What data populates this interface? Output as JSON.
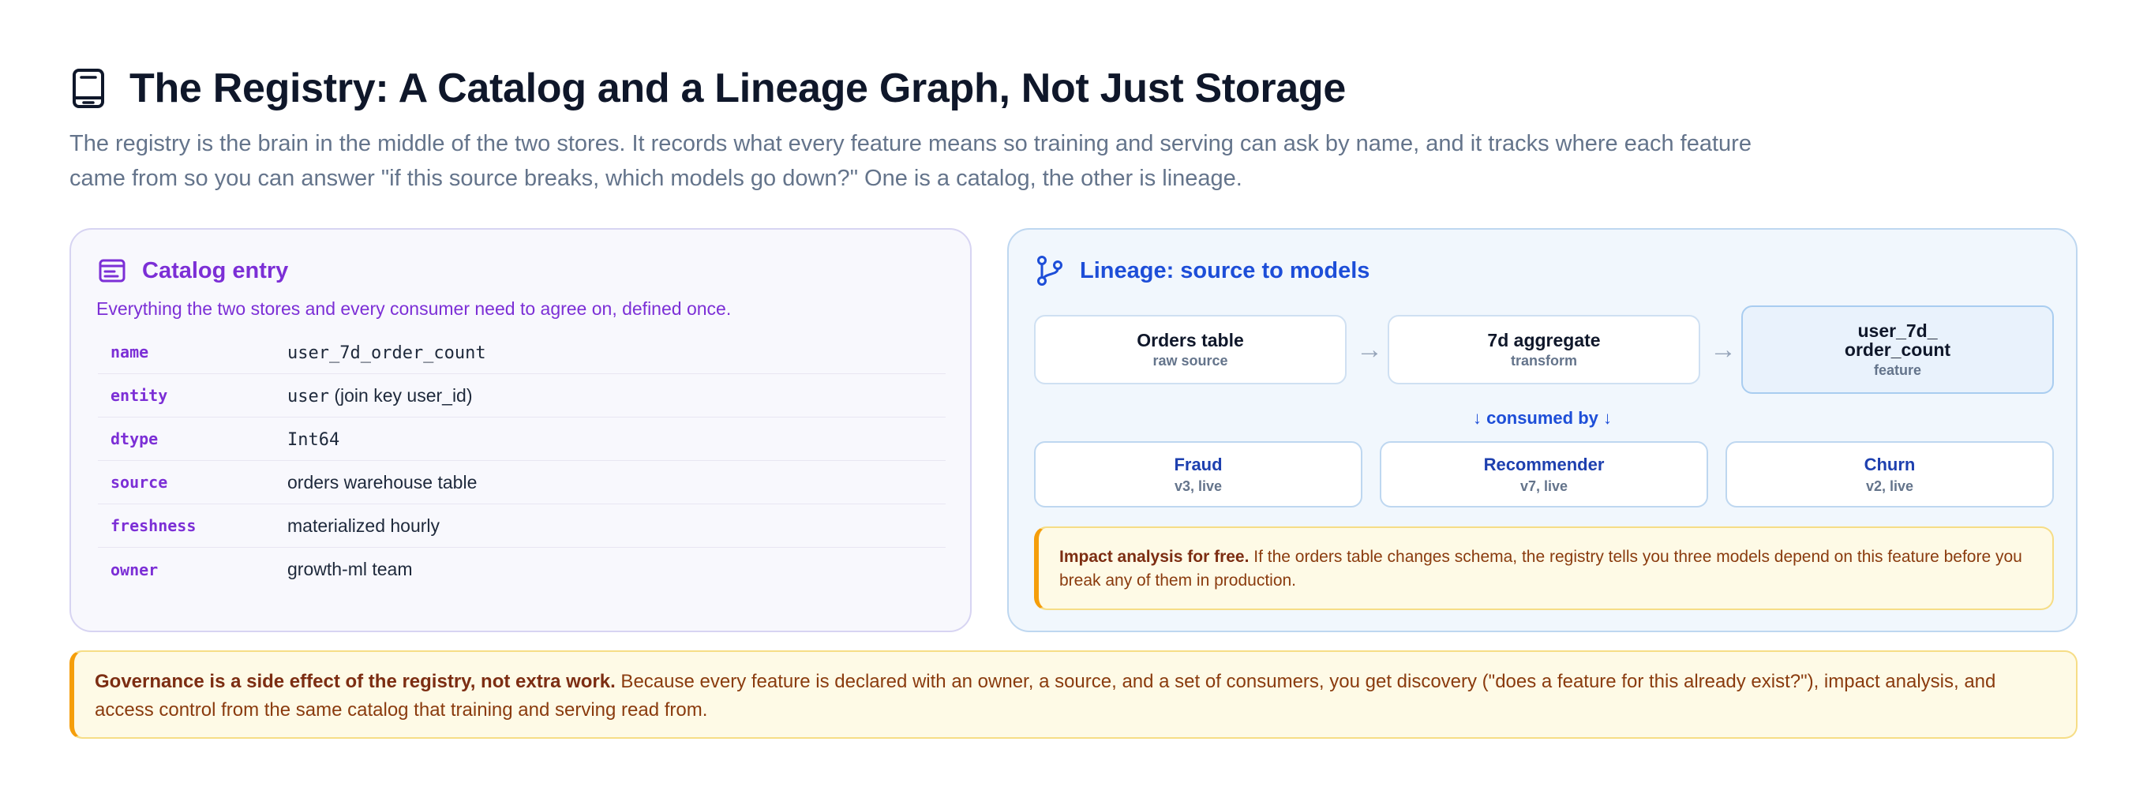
{
  "header": {
    "title": "The Registry: A Catalog and a Lineage Graph, Not Just Storage",
    "intro": "The registry is the brain in the middle of the two stores. It records what every feature means so training and serving can ask by name, and it tracks where each feature came from so you can answer \"if this source breaks, which models go down?\" One is a catalog, the other is lineage.",
    "icon": "book-icon"
  },
  "catalog": {
    "title": "Catalog entry",
    "subtitle": "Everything the two stores and every consumer need to agree on, defined once.",
    "icon": "card-icon",
    "rows": [
      {
        "key": "name",
        "value": "user_7d_order_count"
      },
      {
        "key": "entity",
        "value_mono": "user",
        "value_rest": " (join key user_id)"
      },
      {
        "key": "dtype",
        "value": "Int64"
      },
      {
        "key": "source",
        "value": "orders warehouse table"
      },
      {
        "key": "freshness",
        "value": "materialized hourly"
      },
      {
        "key": "owner",
        "value": "growth-ml team"
      }
    ]
  },
  "lineage": {
    "title": "Lineage: source to models",
    "icon": "branch-icon",
    "flow": [
      {
        "title": "Orders table",
        "sub": "raw source"
      },
      {
        "title": "7d aggregate",
        "sub": "transform"
      },
      {
        "title_line1": "user_7d_",
        "title_line2": "order_count",
        "sub": "feature"
      }
    ],
    "arrow": "→",
    "consumed_by": "↓ consumed by ↓",
    "consumers": [
      {
        "title": "Fraud",
        "sub": "v3, live"
      },
      {
        "title": "Recommender",
        "sub": "v7, live"
      },
      {
        "title": "Churn",
        "sub": "v2, live"
      }
    ],
    "impact_bold": "Impact analysis for free.",
    "impact_text": " If the orders table changes schema, the registry tells you three models depend on this feature before you break any of them in production."
  },
  "governance": {
    "bold": "Governance is a side effect of the registry, not extra work.",
    "text": " Because every feature is declared with an owner, a source, and a set of consumers, you get discovery (\"does a feature for this already exist?\"), impact analysis, and access control from the same catalog that training and serving read from."
  },
  "colors": {
    "catalog_accent": "#7c2fd6",
    "lineage_accent": "#1d4ed8",
    "callout_border": "#f59e0b"
  }
}
